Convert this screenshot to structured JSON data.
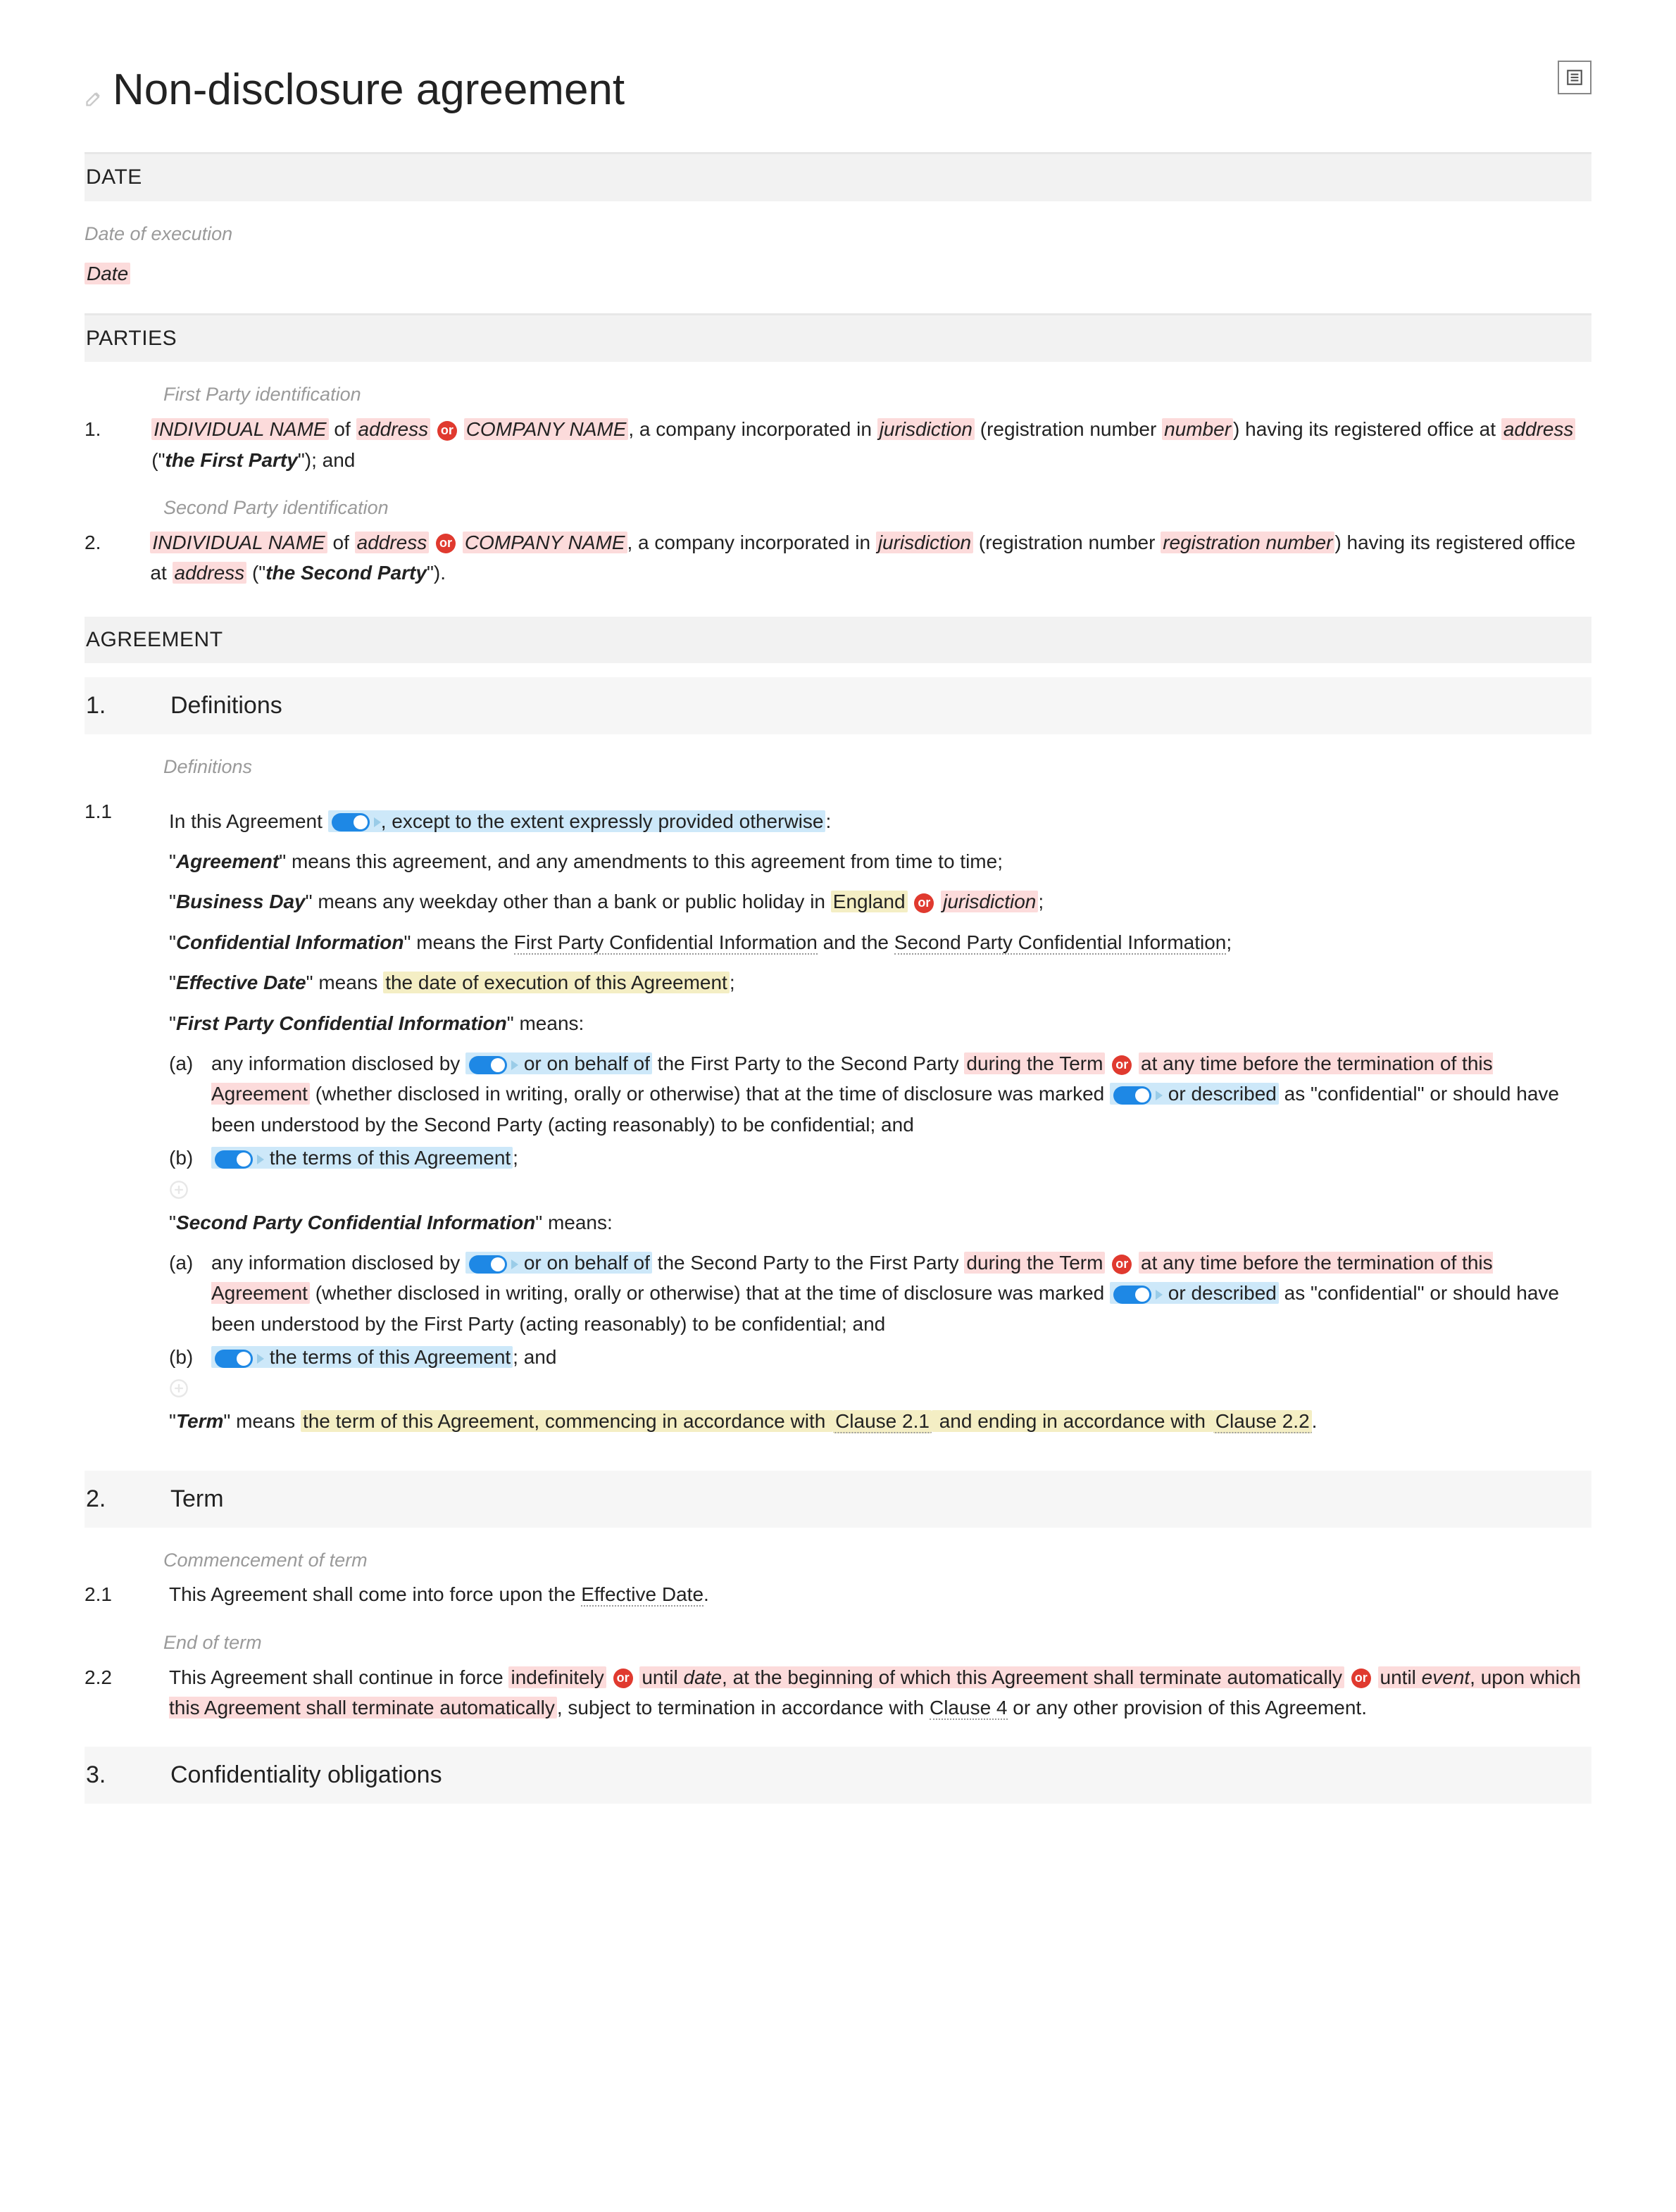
{
  "title": "Non-disclosure agreement",
  "sections": {
    "date": {
      "header": "DATE",
      "label": "Date of execution",
      "field": "Date"
    },
    "parties": {
      "header": "PARTIES",
      "p1label": "First Party identification",
      "p2label": "Second Party identification",
      "num1": "1.",
      "num2": "2.",
      "indiv": "INDIVIDUAL NAME",
      "of": " of ",
      "address": "address",
      "or": "or",
      "company": "COMPANY NAME",
      "incorp": ", a company incorporated in ",
      "juris": "jurisdiction",
      "regnum_open": " (registration number ",
      "number": "number",
      "regnumber2": "registration number",
      "regnum_close": ") having its registered office at ",
      "first_party": "the First Party",
      "second_party": "the Second Party",
      "tail1": "\"); and",
      "tail2": "\")."
    },
    "agreement": {
      "header": "AGREEMENT"
    },
    "defs": {
      "num": "1.",
      "title": "Definitions",
      "label": "Definitions",
      "c11": "1.1",
      "intro1": "In this Agreement",
      "intro2": ", except to the extent expressly provided otherwise",
      "colon": ":",
      "agreement_def": "\" means this agreement, and any amendments to this agreement from time to time;",
      "agreement_term": "Agreement",
      "bday_term": "Business Day",
      "bday_def1": "\" means any weekday other than a bank or public holiday in ",
      "england": "England",
      "bday_juris": "jurisdiction",
      "ci_term": "Confidential Information",
      "ci_def1": "\" means the ",
      "fpci_link": "First Party Confidential Information",
      "ci_and": " and the ",
      "spci_link": "Second Party Confidential Information",
      "ed_term": "Effective Date",
      "ed_def": "the date of execution of this Agreement",
      "ed_means": "\" means ",
      "fpci_term": "First Party Confidential Information",
      "means": "\" means:",
      "a": "(a)",
      "b": "(b)",
      "fp_a1": "any information disclosed by ",
      "onbehalf": "or on behalf of",
      "fp_a2": " the First Party to the Second Party ",
      "during_term": "during the Term",
      "fp_a3": "at any time before the termination of this Agreement",
      "fp_a4": " (whether disclosed in writing, orally or otherwise) that at the time of disclosure was marked ",
      "ordesc": "or described",
      "fp_a5": " as \"confidential\" or should have been understood by the Second Party (acting reasonably) to be confidential; and",
      "terms_agr": "the terms of this Agreement",
      "semi": ";",
      "spci_term": "Second Party Confidential Information",
      "sp_a2": " the Second Party to the First Party ",
      "sp_a5": " as \"confidential\" or should have been understood by the First Party (acting reasonably) to be confidential; and",
      "sp_b_tail": "; and",
      "term_term": "Term",
      "term_def1": "the term of this Agreement, commencing in accordance with ",
      "clause21": "Clause 2.1",
      "term_def2": " and ending in accordance with ",
      "clause22": "Clause 2.2",
      "period": "."
    },
    "term": {
      "num": "2.",
      "title": "Term",
      "l1": "Commencement of term",
      "c21": "2.1",
      "c21_txt1": "This Agreement shall come into force upon the ",
      "eff_date": "Effective Date",
      "l2": "End of term",
      "c22": "2.2",
      "c22_1": "This Agreement shall continue in force ",
      "indef": "indefinitely",
      "until": " until ",
      "date": "date",
      "c22_2": ", at the beginning of which this Agreement shall terminate automatically",
      "event": "event",
      "c22_3": ", upon which this Agreement shall terminate automatically",
      "c22_4": ", subject to termination in accordance with ",
      "clause4": "Clause 4",
      "c22_5": " or any other provision of this Agreement."
    },
    "conf": {
      "num": "3.",
      "title": "Confidentiality obligations"
    }
  }
}
